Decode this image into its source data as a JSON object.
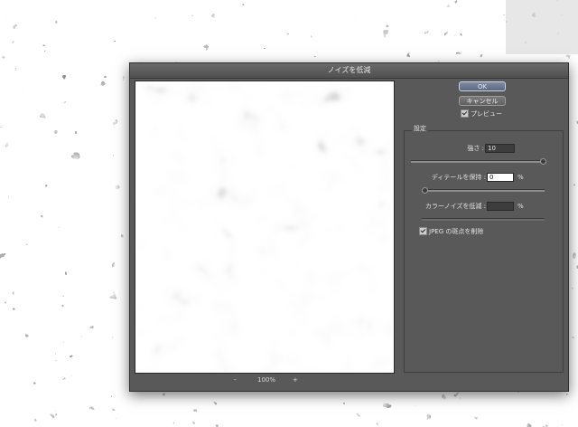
{
  "dialog": {
    "title": "ノイズを低減",
    "ok_label": "OK",
    "cancel_label": "キャンセル",
    "preview_label": "プレビュー",
    "preview_checked": true,
    "zoom": {
      "minus": "-",
      "value": "100%",
      "plus": "+"
    },
    "settings": {
      "legend": "設定",
      "strength": {
        "label": "強さ :",
        "value": "10",
        "slider_fraction": 1.0
      },
      "detail": {
        "label": "ディテールを保持 :",
        "value": "0",
        "unit": "%",
        "slider_fraction": 0.0
      },
      "color_noise": {
        "label": "カラーノイズを低減 :",
        "value": "",
        "unit": "%",
        "disabled": true
      },
      "jpeg": {
        "label": "JPEG の斑点を削除",
        "checked": true
      }
    }
  },
  "colors": {
    "dialog_bg": "#595959",
    "ok_button": "#6b7791"
  }
}
